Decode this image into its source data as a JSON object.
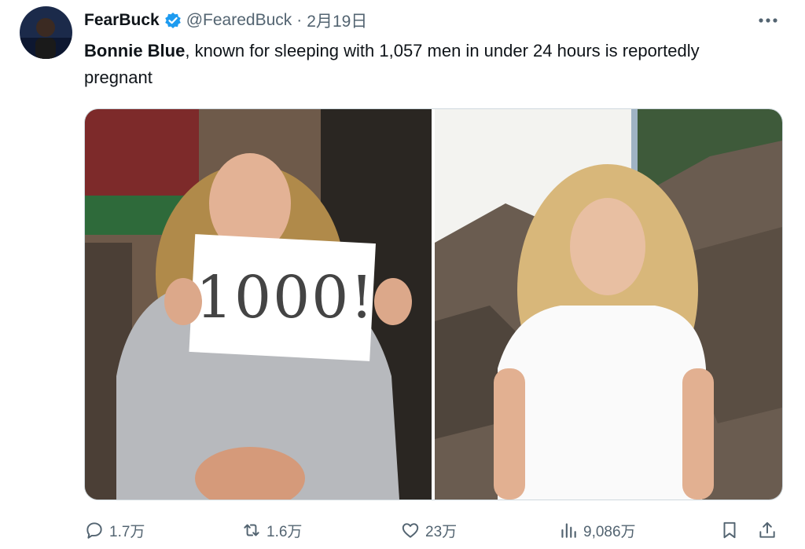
{
  "tweet": {
    "author_name": "FearBuck",
    "handle": "@FearedBuck",
    "separator": "·",
    "date": "2月19日",
    "text_bold": "Bonnie Blue",
    "text_rest": ", known for sleeping with 1,057 men in under 24 hours is reportedly pregnant",
    "sign_text": "1000!"
  },
  "actions": {
    "replies": "1.7万",
    "retweets": "1.6万",
    "likes": "23万",
    "views": "9,086万"
  },
  "icons": {
    "avatar": "avatar-image",
    "verified": "verified-badge-icon",
    "more": "more-icon",
    "reply": "reply-icon",
    "retweet": "retweet-icon",
    "like": "heart-icon",
    "views": "views-chart-icon",
    "bookmark": "bookmark-icon",
    "share": "share-icon"
  },
  "colors": {
    "verified": "#1d9bf0",
    "muted": "#536471",
    "text": "#0f1419"
  }
}
